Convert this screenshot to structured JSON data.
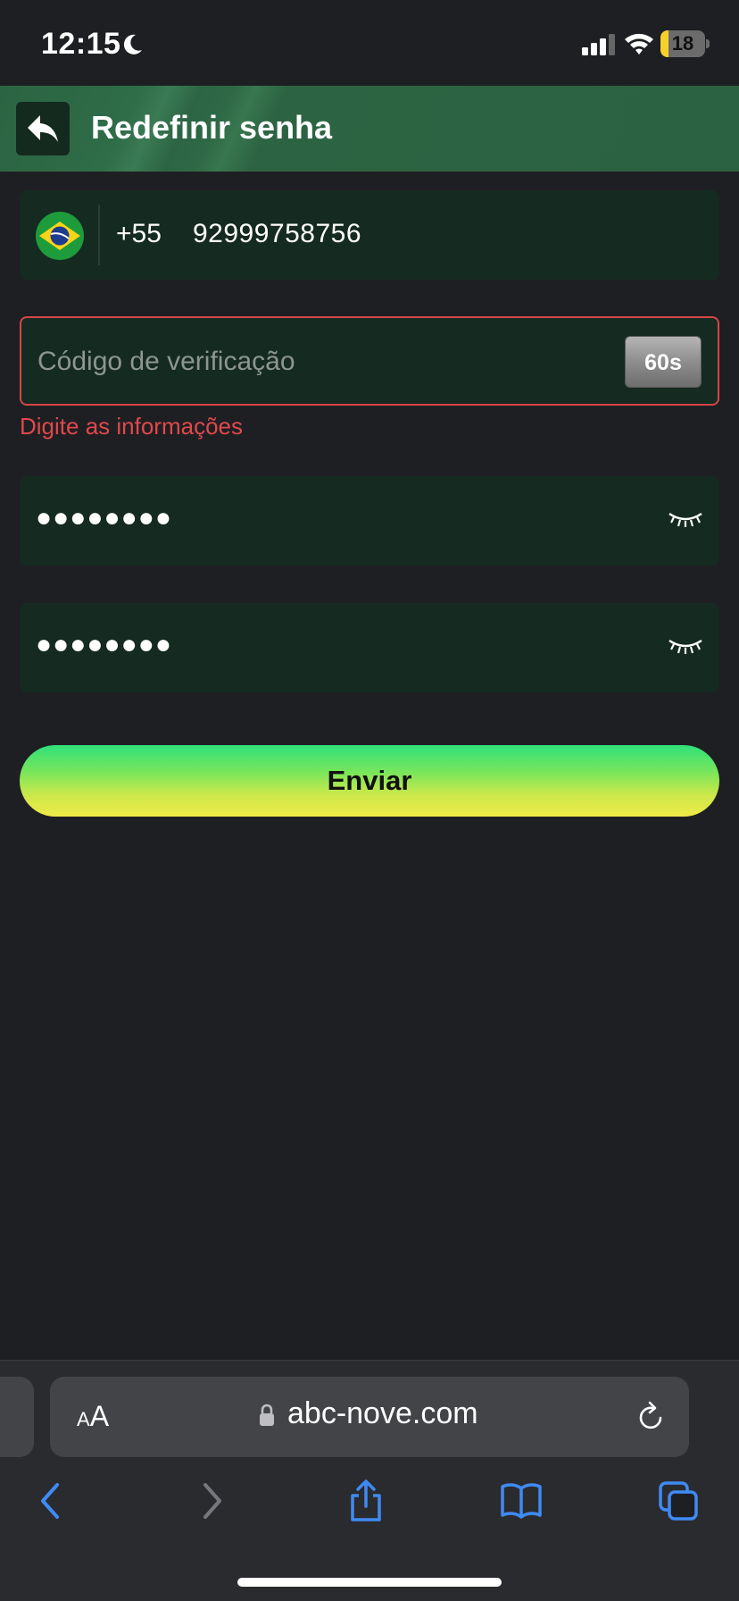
{
  "status_bar": {
    "time": "12:15",
    "battery": "18",
    "battery_level": 0.18
  },
  "header": {
    "title": "Redefinir senha"
  },
  "phone": {
    "country_code": "+55",
    "number": "92999758756"
  },
  "verification": {
    "placeholder": "Código de verificação",
    "countdown": "60s",
    "error": "Digite as informações"
  },
  "password": {
    "masked": "●●●●●●●●"
  },
  "confirm_password": {
    "masked": "●●●●●●●●"
  },
  "submit_label": "Enviar",
  "browser": {
    "text_size_label_small": "A",
    "text_size_label_large": "A",
    "url": "abc-nove.com"
  },
  "colors": {
    "accent_green": "#2b6442",
    "error": "#e0484b",
    "field_bg": "#152a20",
    "link_blue": "#3f8bf4"
  },
  "icons": [
    "moon-icon",
    "signal-icon",
    "wifi-icon",
    "battery-icon",
    "back-arrow-icon",
    "brazil-flag-icon",
    "eye-closed-icon",
    "lock-icon",
    "reload-icon",
    "back-icon",
    "forward-icon",
    "share-icon",
    "bookmarks-icon",
    "tabs-icon"
  ]
}
